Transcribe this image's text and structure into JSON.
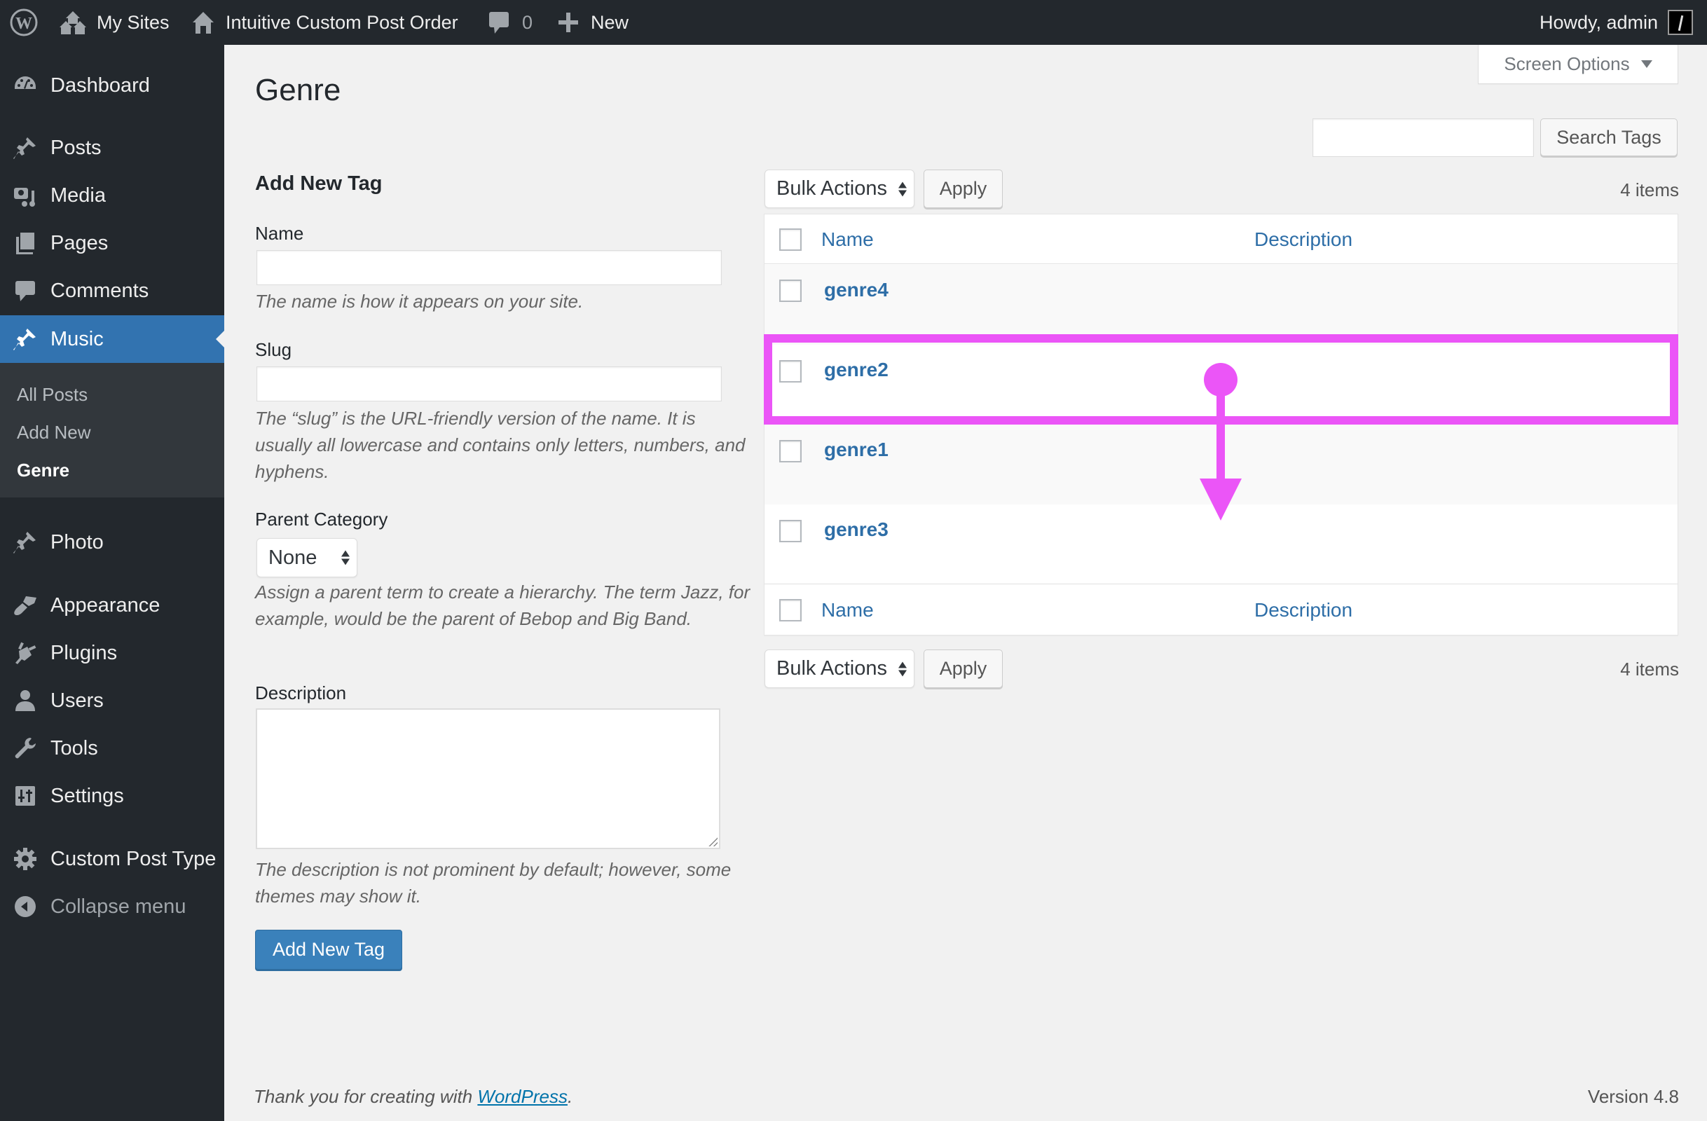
{
  "adminbar": {
    "logo_icon": "wordpress-logo-icon",
    "my_sites": "My Sites",
    "site_name": "Intuitive Custom Post Order",
    "comments_count": "0",
    "new_label": "New",
    "howdy": "Howdy, admin"
  },
  "sidebar": {
    "items": [
      {
        "label": "Dashboard",
        "icon": "dashboard-icon"
      },
      {
        "label": "Posts",
        "icon": "pin-icon"
      },
      {
        "label": "Media",
        "icon": "media-icon"
      },
      {
        "label": "Pages",
        "icon": "pages-icon"
      },
      {
        "label": "Comments",
        "icon": "comment-icon"
      },
      {
        "label": "Music",
        "icon": "pin-icon",
        "active": true
      },
      {
        "label": "Photo",
        "icon": "pin-icon"
      },
      {
        "label": "Appearance",
        "icon": "brush-icon"
      },
      {
        "label": "Plugins",
        "icon": "plugin-icon"
      },
      {
        "label": "Users",
        "icon": "user-icon"
      },
      {
        "label": "Tools",
        "icon": "wrench-icon"
      },
      {
        "label": "Settings",
        "icon": "settings-icon"
      },
      {
        "label": "Custom Post Type",
        "icon": "gear-icon"
      },
      {
        "label": "Collapse menu",
        "icon": "collapse-icon"
      }
    ],
    "submenu": [
      "All Posts",
      "Add New",
      "Genre"
    ]
  },
  "screen_options": "Screen Options",
  "page_title": "Genre",
  "search": {
    "value": "",
    "button": "Search Tags"
  },
  "form": {
    "heading": "Add New Tag",
    "name_label": "Name",
    "name_value": "",
    "name_help": "The name is how it appears on your site.",
    "slug_label": "Slug",
    "slug_value": "",
    "slug_help": "The “slug” is the URL-friendly version of the name. It is usually all lowercase and contains only letters, numbers, and hyphens.",
    "parent_label": "Parent Category",
    "parent_value": "None",
    "parent_help": "Assign a parent term to create a hierarchy. The term Jazz, for example, would be the parent of Bebop and Big Band.",
    "description_label": "Description",
    "description_value": "",
    "description_help": "The description is not prominent by default; however, some themes may show it.",
    "submit": "Add New Tag"
  },
  "table": {
    "bulk_actions": "Bulk Actions",
    "apply": "Apply",
    "items_count": "4 items",
    "columns": [
      "Name",
      "Description"
    ],
    "rows": [
      {
        "name": "genre4",
        "description": ""
      },
      {
        "name": "genre2",
        "description": ""
      },
      {
        "name": "genre1",
        "description": ""
      },
      {
        "name": "genre3",
        "description": ""
      }
    ]
  },
  "annotation": {
    "color": "#eb55f7",
    "highlighted_row": "genre2",
    "meaning": "drag genre2 down"
  },
  "footer": {
    "thanks_prefix": "Thank you for creating with ",
    "thanks_link": "WordPress",
    "thanks_suffix": ".",
    "version": "Version 4.8"
  }
}
